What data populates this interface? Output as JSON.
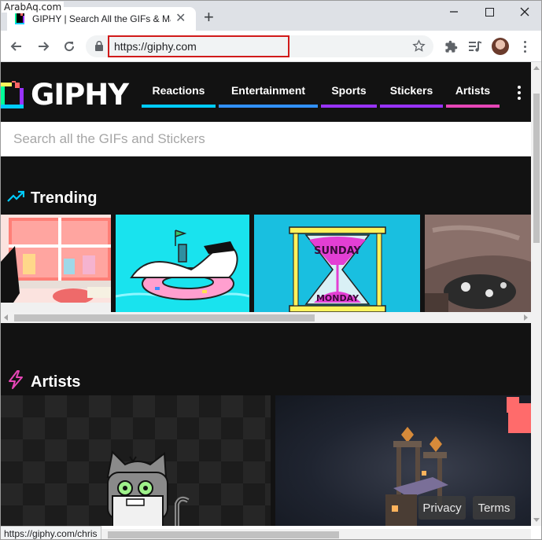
{
  "watermark": "ArabAq.com",
  "browser": {
    "tab_title": "GIPHY | Search All the GIFs & Ma",
    "url": "https://giphy.com"
  },
  "site": {
    "logo_text": "GIPHY",
    "nav": [
      {
        "label": "Reactions",
        "color": "#00ccff"
      },
      {
        "label": "Entertainment",
        "color": "#3191ff"
      },
      {
        "label": "Sports",
        "color": "#9933ff"
      },
      {
        "label": "Stickers",
        "color": "#9933ff"
      },
      {
        "label": "Artists",
        "color": "#e646b6"
      }
    ],
    "search_placeholder": "Search all the GIFs and Stickers",
    "trending_title": "Trending",
    "artists_title": "Artists",
    "footer": {
      "privacy": "Privacy",
      "terms": "Terms"
    }
  },
  "hourglass_text": {
    "top": "SUNDAY",
    "bottom": "MONDAY"
  },
  "status_url": "https://giphy.com/chris",
  "colors": {
    "page_bg": "#121212",
    "trending_icon": "#00ccff",
    "artists_icon": "#e646b6",
    "url_highlight": "#d11a1a"
  }
}
